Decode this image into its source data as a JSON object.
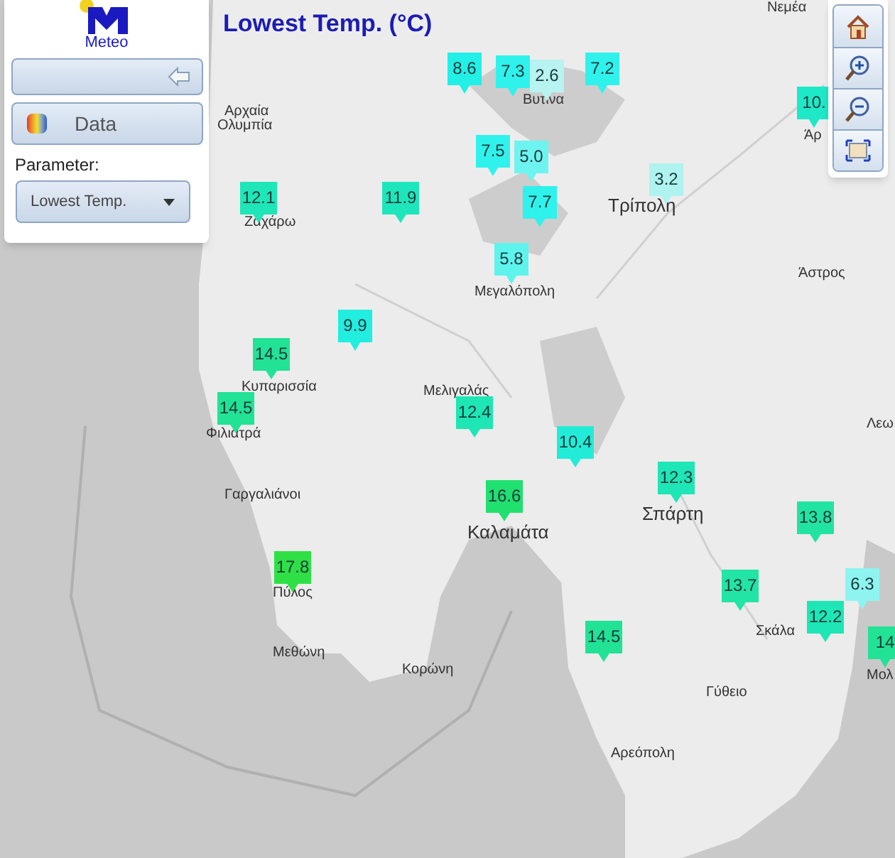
{
  "title": "Lowest Temp. (°C)",
  "sidebar": {
    "logo_text": "Meteo",
    "section": {
      "label": "Data"
    },
    "parameter": {
      "label": "Parameter:",
      "value": "Lowest Temp."
    }
  },
  "map_controls": [
    {
      "kind": "home"
    },
    {
      "kind": "zoom_in"
    },
    {
      "kind": "zoom_out"
    },
    {
      "kind": "full_extent"
    }
  ],
  "places": [
    {
      "name": "Νεμέα"
    },
    {
      "name": "Αρχαία"
    },
    {
      "name": "Ολυμπία"
    },
    {
      "name": "Ζαχάρω"
    },
    {
      "name": "Βυτίνα"
    },
    {
      "name": "Τρίπολη"
    },
    {
      "name": "Άρ"
    },
    {
      "name": "Άστρος"
    },
    {
      "name": "Μεγαλόπολη"
    },
    {
      "name": "Κυπαρισσία"
    },
    {
      "name": "Μελιγαλάς"
    },
    {
      "name": "Φιλιατρά"
    },
    {
      "name": "Λεω"
    },
    {
      "name": "Γαργαλιάνοι"
    },
    {
      "name": "Σπάρτη"
    },
    {
      "name": "Καλαμάτα"
    },
    {
      "name": "Πύλος"
    },
    {
      "name": "Σκάλα"
    },
    {
      "name": "Μεθώνη"
    },
    {
      "name": "Μολ"
    },
    {
      "name": "Κορώνη"
    },
    {
      "name": "Γύθειο"
    },
    {
      "name": "Αρεόπολη"
    }
  ],
  "stations": [
    {
      "value": "8.6",
      "color": "#22f0e6"
    },
    {
      "value": "7.3",
      "color": "#30f2ec"
    },
    {
      "value": "2.6",
      "color": "#b6f3f1"
    },
    {
      "value": "7.2",
      "color": "#30f2ec"
    },
    {
      "value": "10.",
      "color": "#1ee8c8"
    },
    {
      "value": "7.5",
      "color": "#30f2ec"
    },
    {
      "value": "5.0",
      "color": "#6ef4f0"
    },
    {
      "value": "7.7",
      "color": "#30f2ec"
    },
    {
      "value": "3.2",
      "color": "#aef3f0"
    },
    {
      "value": "12.1",
      "color": "#1ee6b8"
    },
    {
      "value": "11.9",
      "color": "#1ee6bc"
    },
    {
      "value": "5.8",
      "color": "#5ef4ee"
    },
    {
      "value": "9.9",
      "color": "#22eee0"
    },
    {
      "value": "14.5",
      "color": "#22e296"
    },
    {
      "value": "14.5",
      "color": "#22e296"
    },
    {
      "value": "12.4",
      "color": "#1ee6b4"
    },
    {
      "value": "10.4",
      "color": "#22ecd8"
    },
    {
      "value": "12.3",
      "color": "#1ee6b6"
    },
    {
      "value": "16.6",
      "color": "#20e070"
    },
    {
      "value": "13.8",
      "color": "#22e4a2"
    },
    {
      "value": "17.8",
      "color": "#2ee046"
    },
    {
      "value": "13.7",
      "color": "#22e4a4"
    },
    {
      "value": "6.3",
      "color": "#8ef4f0"
    },
    {
      "value": "12.2",
      "color": "#1ee6b6"
    },
    {
      "value": "14.5",
      "color": "#22e296"
    },
    {
      "value": "14",
      "color": "#22e296"
    }
  ]
}
